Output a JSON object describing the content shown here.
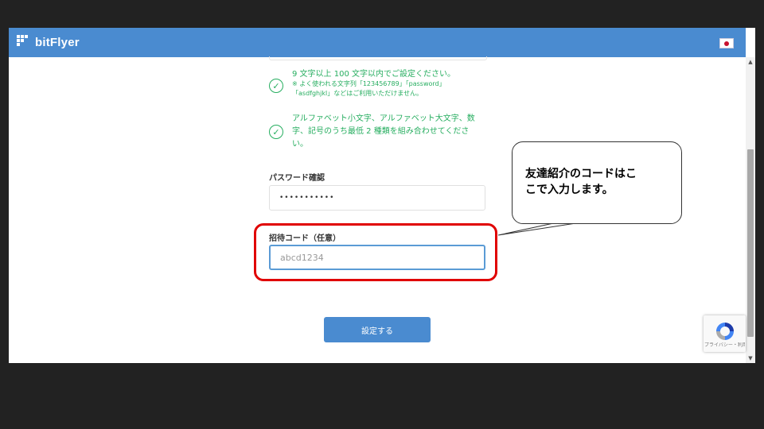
{
  "app": {
    "name": "bitFlyer",
    "flag": "Japan"
  },
  "password_rules": [
    {
      "text": "9 文字以上 100 文字以内でご設定ください。",
      "note_line1": "※ よく使われる文字列「123456789」「password」",
      "note_line2": "「asdfghjkl」などはご利用いただけません。"
    },
    {
      "line1": "アルファベット小文字、アルファベット大文字、数",
      "line2": "字、記号のうち最低 2 種類を組み合わせてくださ",
      "line3": "い。"
    }
  ],
  "password_confirm": {
    "label": "パスワード確認",
    "value": "•••••••••••"
  },
  "invite_code": {
    "label": "招待コード（任意）",
    "placeholder": "abcd1234",
    "value": ""
  },
  "submit_label": "設定する",
  "recaptcha": {
    "text": "プライバシー・利用規約"
  },
  "callout": {
    "line1": "友達紹介のコードはこ",
    "line2": "こで入力します。"
  },
  "colors": {
    "brand": "#4a8bd0",
    "success": "#27ae60",
    "highlight": "#e00000"
  }
}
